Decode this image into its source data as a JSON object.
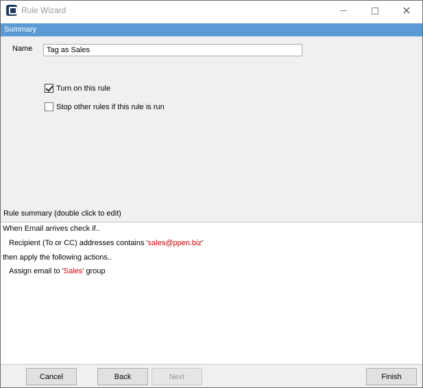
{
  "window": {
    "title": "Rule Wizard",
    "minimize_icon": "minimize-icon",
    "maximize_icon": "maximize-icon",
    "close_icon": "close-icon"
  },
  "section": {
    "header": "Summary"
  },
  "form": {
    "name_label": "Name",
    "name_value": "Tag as Sales",
    "turn_on_label": "Turn on this rule",
    "turn_on_checked": true,
    "stop_other_label": "Stop other rules if this rule is run",
    "stop_other_checked": false
  },
  "summary": {
    "label": "Rule summary (double click to edit)",
    "line1": "When Email arrives check if..",
    "line2_prefix": "Recipient (To or CC) addresses contains '",
    "line2_value": "sales@ppen.biz",
    "line2_suffix": "'",
    "line3": "then apply the following actions..",
    "line4_prefix": "Assign email to '",
    "line4_value": "Sales",
    "line4_suffix": "' group"
  },
  "buttons": {
    "cancel": "Cancel",
    "back": "Back",
    "next": "Next",
    "finish": "Finish"
  },
  "colors": {
    "header_bg": "#5b9bd5",
    "highlight": "#cc0000"
  }
}
